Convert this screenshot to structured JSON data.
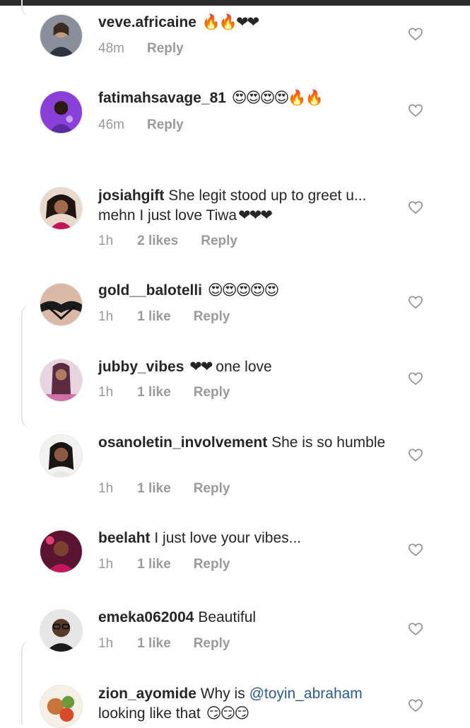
{
  "icons": {
    "like": "heart-outline-icon"
  },
  "colors": {
    "text": "#262626",
    "muted": "#9a9a9a",
    "mention": "#2e5b8a"
  },
  "comments": [
    {
      "username": "veve.africaine",
      "text": "",
      "emoji": "🔥🔥❤❤",
      "time": "48m",
      "likes": "",
      "reply": "Reply"
    },
    {
      "username": "fatimahsavage_81",
      "text": "",
      "emoji": "😍😍😍😍🔥🔥",
      "time": "46m",
      "likes": "",
      "reply": "Reply"
    },
    {
      "username": "josiahgift",
      "text": "She legit stood up to greet u... mehn I just love Tiwa",
      "emoji": "❤❤❤",
      "time": "1h",
      "likes": "2 likes",
      "reply": "Reply"
    },
    {
      "username": "gold__balotelli",
      "text": "",
      "emoji": "😍😍😍😍😍",
      "time": "1h",
      "likes": "1 like",
      "reply": "Reply"
    },
    {
      "username": "jubby_vibes",
      "text": "one love",
      "emoji": "❤❤",
      "time": "1h",
      "likes": "1 like",
      "reply": "Reply"
    },
    {
      "username": "osanoletin_involvement",
      "text": "She is so humble",
      "emoji": "",
      "time": "1h",
      "likes": "1 like",
      "reply": "Reply"
    },
    {
      "username": "beelaht",
      "text": "I just love your vibes...",
      "emoji": "",
      "time": "1h",
      "likes": "1 like",
      "reply": "Reply"
    },
    {
      "username": "emeka062004",
      "text": "Beautiful",
      "emoji": "",
      "time": "1h",
      "likes": "1 like",
      "reply": "Reply"
    },
    {
      "username": "zion_ayomide",
      "text_before": "Why is",
      "mention": "@toyin_abraham",
      "text_after": "looking like that",
      "emoji": "😏😏😏",
      "time": "",
      "likes": "",
      "reply": ""
    }
  ]
}
